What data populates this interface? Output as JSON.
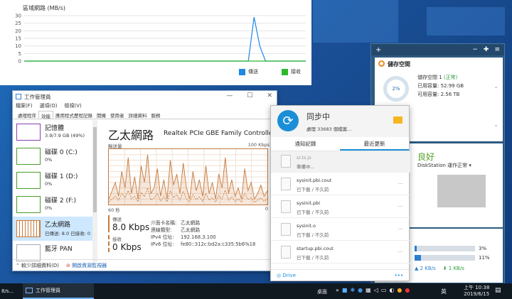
{
  "network_chart": {
    "title": "區域網路 (MB/s)",
    "legend": [
      {
        "label": "傳送",
        "color": "#1e88e5"
      },
      {
        "label": "接收",
        "color": "#2db82d"
      }
    ],
    "chart_data": {
      "type": "line",
      "ylabel": "區域網路 (MB/s)",
      "ylim": [
        0,
        30
      ],
      "yticks": [
        "0",
        "5",
        "10",
        "15",
        "20",
        "25",
        "30"
      ],
      "series": [
        {
          "name": "傳送",
          "values": [
            0,
            0,
            0,
            0,
            0,
            0,
            0,
            0,
            0,
            0,
            0,
            0,
            0,
            0,
            0,
            0,
            0,
            0,
            0,
            0,
            0,
            0,
            0,
            0,
            0,
            0,
            0,
            0,
            0,
            0,
            0,
            0,
            0,
            0,
            0,
            0,
            0,
            0,
            0,
            0,
            29,
            10,
            0,
            0,
            0,
            0,
            0,
            0,
            0,
            0
          ]
        },
        {
          "name": "接收",
          "values": [
            0,
            0,
            0,
            0,
            0,
            0,
            0,
            0,
            0,
            0,
            0,
            0,
            0,
            0,
            0,
            0,
            0,
            0,
            0,
            0,
            0,
            0,
            0,
            0,
            0,
            0,
            0,
            0,
            0,
            0,
            0,
            0,
            0,
            0,
            0,
            0,
            0,
            0,
            0,
            0,
            0,
            0,
            0,
            0,
            0,
            0,
            0,
            0,
            0,
            0
          ]
        }
      ]
    }
  },
  "widget": {
    "plus": "+",
    "header_icons": [
      "−",
      "✚",
      "≡"
    ],
    "storage": {
      "title": "儲存空間",
      "percent": "2%",
      "percent_value": 0.02,
      "volume": "儲存空間 1",
      "status": "(正常)",
      "used": "已用容量: 52.99 GB",
      "free": "可用容量: 2.56 TB"
    },
    "health": {
      "title": "良好",
      "subtitle": "DiskStation 運作正常 ▾"
    },
    "resource": {
      "cpu_pct": "3%",
      "cpu_value": 0.03,
      "ram_pct": "11%",
      "ram_value": 0.11,
      "up": "▲ 2 KB/s",
      "down": "⬇ 1 KB/s"
    }
  },
  "task_manager": {
    "title": "工作管理員",
    "menu": [
      "檔案(F)",
      "選項(O)",
      "檢視(V)"
    ],
    "tabs": [
      "處理程序",
      "效能",
      "應用程式歷程記錄",
      "開機",
      "使用者",
      "詳細資料",
      "服務"
    ],
    "active_tab": "效能",
    "side_items": [
      {
        "name": "記憶體",
        "sub": "3.9/7.9 GB (49%)"
      },
      {
        "name": "磁碟 0 (C:)",
        "sub": "0%"
      },
      {
        "name": "磁碟 1 (D:)",
        "sub": "0%"
      },
      {
        "name": "磁碟 2 (F:)",
        "sub": "0%"
      },
      {
        "name": "乙太網路",
        "sub": "已傳送: 8.0 已接收: 0"
      },
      {
        "name": "藍牙 PAN",
        "sub": ""
      }
    ],
    "main": {
      "heading": "乙太網路",
      "adapter": "Realtek PCIe GBE Family Controller",
      "throughput_label": "輸送量",
      "max_label": "100 Kbps",
      "time_label": "60 秒",
      "zero_label": "0",
      "send_label": "傳送",
      "send_value": "8.0 Kbps",
      "recv_label": "接收",
      "recv_value": "0 Kbps",
      "details": [
        {
          "k": "介面卡名稱:",
          "v": "乙太網路"
        },
        {
          "k": "連線類型:",
          "v": "乙太網路"
        },
        {
          "k": "IPv4 位址:",
          "v": "192.168.3.100"
        },
        {
          "k": "IPv6 位址:",
          "v": "fe80::312c:bd2a:c335:5b6%18"
        }
      ],
      "graph_send": [
        10,
        25,
        40,
        15,
        60,
        30,
        85,
        20,
        50,
        10,
        70,
        40,
        90,
        20,
        30,
        65,
        15,
        45,
        10,
        80,
        35,
        55,
        20,
        75,
        30,
        10,
        60,
        25,
        45,
        15,
        70,
        20,
        40,
        10,
        55,
        30,
        85,
        20,
        45,
        15,
        30,
        10,
        65,
        25,
        40,
        10,
        20,
        35,
        15,
        25
      ],
      "graph_recv": [
        5,
        10,
        15,
        8,
        20,
        12,
        25,
        10,
        15,
        5,
        22,
        14,
        30,
        8,
        12,
        20,
        6,
        15,
        5,
        25,
        12,
        18,
        8,
        24,
        10,
        5,
        18,
        9,
        14,
        6,
        20,
        8,
        12,
        5,
        16,
        10,
        26,
        8,
        14,
        6,
        10,
        5,
        20,
        9,
        12,
        4,
        8,
        12,
        6,
        10
      ]
    },
    "footer": {
      "less": "較少詳細資料(D)",
      "open": "開啟資源監視器"
    }
  },
  "drive": {
    "status": "同步中",
    "processing": "處理 33683 個檔案...",
    "tabs": [
      "通知記錄",
      "最近更新"
    ],
    "active_tab": "最近更新",
    "files": [
      {
        "name": "sr.ts.js",
        "state": "準備中...",
        "gray": true
      },
      {
        "name": "sysinit.pbi.cout",
        "state": "已下載 / 不久前",
        "gray": false
      },
      {
        "name": "sysinit.pbi",
        "state": "已下載 / 不久前",
        "gray": false
      },
      {
        "name": "sysinit.o",
        "state": "已下載 / 不久前",
        "gray": false
      },
      {
        "name": "startup.pbi.cout",
        "state": "已下載 / 不久前",
        "gray": false
      }
    ],
    "footer_app": "Drive",
    "footer_more": "•••"
  },
  "taskbar": {
    "left_text": "8/s...",
    "app": "工作管理員",
    "desktop": "桌面",
    "lang": "英",
    "time": "上午 10:38",
    "date": "2019/6/15"
  }
}
